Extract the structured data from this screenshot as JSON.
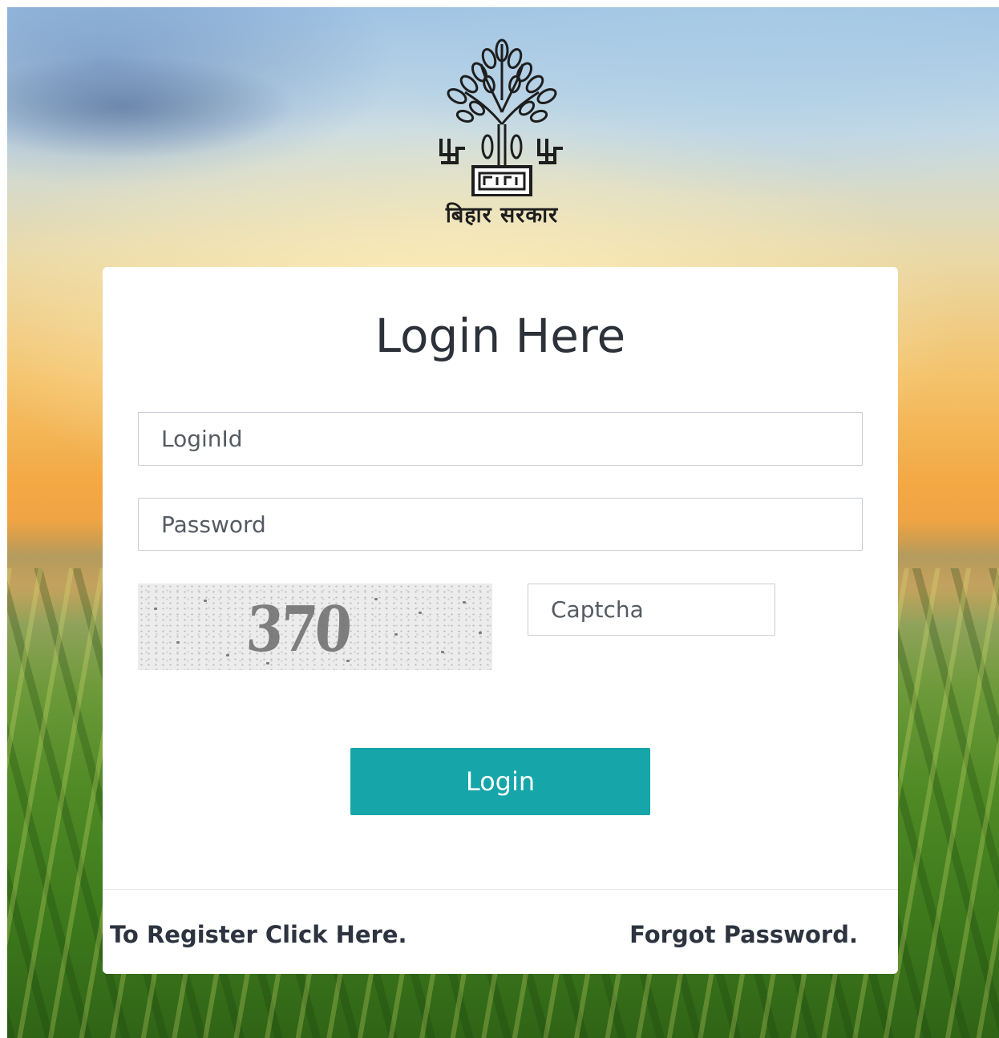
{
  "logo": {
    "caption": "बिहार सरकार",
    "icon": "bihar-government-tree-emblem"
  },
  "login_form": {
    "title": "Login Here",
    "login_id_placeholder": "LoginId",
    "password_placeholder": "Password",
    "captcha_value": "370",
    "captcha_placeholder": "Captcha",
    "submit_label": "Login"
  },
  "footer_links": {
    "register": "To Register Click Here.",
    "forgot_password": "Forgot Password."
  },
  "colors": {
    "accent": "#16a6a9",
    "card_background": "#ffffff",
    "text_dark": "#2c313a"
  }
}
